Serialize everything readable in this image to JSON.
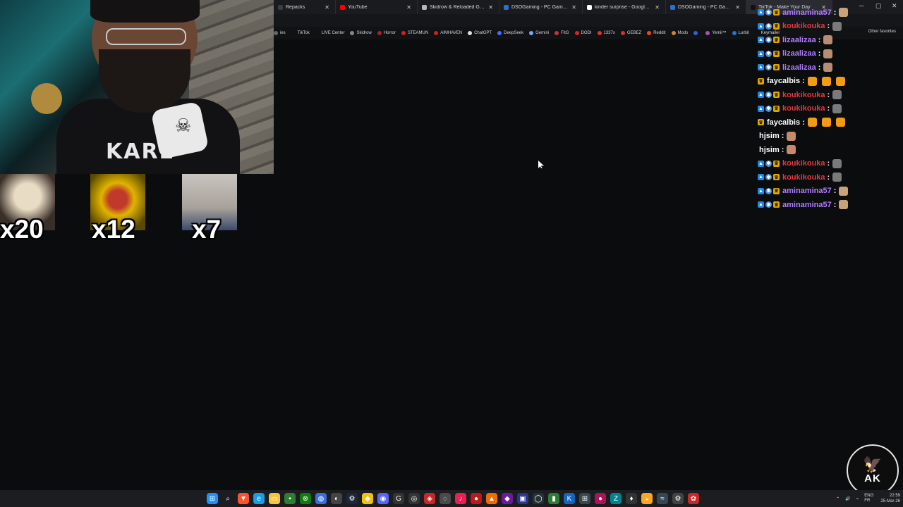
{
  "browser": {
    "tabs": [
      {
        "label": "Repacks",
        "color": "#3b3d42",
        "active": false
      },
      {
        "label": "YouTube",
        "color": "#ff0000",
        "active": false
      },
      {
        "label": "Skidrow & Reloaded Games – D",
        "color": "#b8b8b8",
        "active": false
      },
      {
        "label": "DSOGaming - PC Games News, S",
        "color": "#2a6fd6",
        "active": false
      },
      {
        "label": "kinder surprise - Google Search",
        "color": "#ffffff",
        "active": false
      },
      {
        "label": "DSOGaming - PC Games News, S",
        "color": "#2a6fd6",
        "active": false
      },
      {
        "label": "TikTok - Make Your Day",
        "color": "#111111",
        "active": true
      }
    ],
    "window_controls": [
      "─",
      "▢",
      "✕"
    ],
    "bookmarks": [
      {
        "label": "ies",
        "color": "#666666"
      },
      {
        "label": "TikTok",
        "color": "#111111"
      },
      {
        "label": "LIVE Center",
        "color": "#111111"
      },
      {
        "label": "Skidrow",
        "color": "#888888"
      },
      {
        "label": "Horror",
        "color": "#aa2222"
      },
      {
        "label": "STEAMUN",
        "color": "#cc2222"
      },
      {
        "label": "AIMHAVEN",
        "color": "#cc2222"
      },
      {
        "label": "ChatGPT",
        "color": "#dddddd"
      },
      {
        "label": "DeepSeek",
        "color": "#4d6bfe"
      },
      {
        "label": "Gemini",
        "color": "#7aa7ff"
      },
      {
        "label": "FitG",
        "color": "#cc3333"
      },
      {
        "label": "DODI",
        "color": "#dd2222"
      },
      {
        "label": "1337x",
        "color": "#dd3333"
      },
      {
        "label": "GEBEZ",
        "color": "#cc3333"
      },
      {
        "label": "Reddit",
        "color": "#ff4500"
      },
      {
        "label": "Mods",
        "color": "#d9822b"
      },
      {
        "label": "",
        "color": "#3b5bdb"
      },
      {
        "label": "Yemii™",
        "color": "#9b59b6"
      },
      {
        "label": "Lurbit",
        "color": "#2a6fd6"
      },
      {
        "label": "Keymailer",
        "color": "#111111"
      }
    ],
    "other_favorites": "Other favorites"
  },
  "gifts": [
    {
      "count": "x20",
      "color": "#d8c7a6"
    },
    {
      "count": "x12",
      "color": "#e0b400"
    },
    {
      "count": "x7",
      "color": "#b7b2ad"
    }
  ],
  "chat": [
    {
      "user": "aminamina57",
      "color": "#b07cff",
      "badges": 3,
      "emotes": [
        "#c9a27a"
      ]
    },
    {
      "user": "koukikouka",
      "color": "#e5383b",
      "badges": 3,
      "emotes": [
        "#7a7a7a"
      ]
    },
    {
      "user": "lizaalizaa",
      "color": "#b07cff",
      "badges": 3,
      "emotes": [
        "#b98c74"
      ]
    },
    {
      "user": "lizaalizaa",
      "color": "#b07cff",
      "badges": 3,
      "emotes": [
        "#b98c74"
      ]
    },
    {
      "user": "lizaalizaa",
      "color": "#b07cff",
      "badges": 3,
      "emotes": [
        "#b98c74"
      ]
    },
    {
      "user": "faycalbis",
      "color": "#ffffff",
      "badges": 1,
      "emotes": [
        "#f39c12",
        "#f39c12",
        "#f39c12"
      ]
    },
    {
      "user": "koukikouka",
      "color": "#e5383b",
      "badges": 3,
      "emotes": [
        "#7a7a7a"
      ]
    },
    {
      "user": "koukikouka",
      "color": "#e5383b",
      "badges": 3,
      "emotes": [
        "#7a7a7a"
      ]
    },
    {
      "user": "faycalbis",
      "color": "#ffffff",
      "badges": 1,
      "emotes": [
        "#f39c12",
        "#f39c12",
        "#f39c12"
      ]
    },
    {
      "user": "hjsim",
      "color": "#ffffff",
      "badges": 0,
      "emotes": [
        "#c58a6a"
      ]
    },
    {
      "user": "hjsim",
      "color": "#ffffff",
      "badges": 0,
      "emotes": [
        "#c58a6a"
      ]
    },
    {
      "user": "koukikouka",
      "color": "#e5383b",
      "badges": 3,
      "emotes": [
        "#7a7a7a"
      ]
    },
    {
      "user": "koukikouka",
      "color": "#e5383b",
      "badges": 3,
      "emotes": [
        "#7a7a7a"
      ]
    },
    {
      "user": "aminamina57",
      "color": "#b07cff",
      "badges": 3,
      "emotes": [
        "#c9a27a"
      ]
    },
    {
      "user": "aminamina57",
      "color": "#b07cff",
      "badges": 3,
      "emotes": [
        "#c9a27a"
      ]
    }
  ],
  "chat_separator": ":",
  "webcam": {
    "shirt_text": "KARL"
  },
  "logo": {
    "mark": "AK"
  },
  "taskbar": {
    "icons": [
      {
        "name": "windows-start-icon",
        "color": "#1e90ff",
        "glyph": "⊞"
      },
      {
        "name": "search-icon",
        "color": "transparent",
        "glyph": "⌕"
      },
      {
        "name": "brave-icon",
        "color": "#fb542b",
        "glyph": "▼"
      },
      {
        "name": "edge-icon",
        "color": "#1b9de2",
        "glyph": "e"
      },
      {
        "name": "file-explorer-icon",
        "color": "#f5c542",
        "glyph": "▭"
      },
      {
        "name": "app-green-icon",
        "color": "#2e7d32",
        "glyph": "▪"
      },
      {
        "name": "xbox-icon",
        "color": "#107c10",
        "glyph": "⊗"
      },
      {
        "name": "app-blue-icon",
        "color": "#3a6fd8",
        "glyph": "◍"
      },
      {
        "name": "app-circle-icon",
        "color": "#444444",
        "glyph": "◐"
      },
      {
        "name": "steam-icon",
        "color": "#1b2838",
        "glyph": "⚙"
      },
      {
        "name": "app-yellow-icon",
        "color": "#f4c20d",
        "glyph": "◆"
      },
      {
        "name": "discord-icon",
        "color": "#5865f2",
        "glyph": "◉"
      },
      {
        "name": "google-icon",
        "color": "#333333",
        "glyph": "G"
      },
      {
        "name": "obs-icon",
        "color": "#333333",
        "glyph": "◎"
      },
      {
        "name": "app-red-icon",
        "color": "#c62828",
        "glyph": "◈"
      },
      {
        "name": "app-grey-icon",
        "color": "#4a4a4a",
        "glyph": "◌"
      },
      {
        "name": "tiktok-icon",
        "color": "#ee1d52",
        "glyph": "♪"
      },
      {
        "name": "app-red2-icon",
        "color": "#b71c1c",
        "glyph": "●"
      },
      {
        "name": "app-orange-icon",
        "color": "#ef6c00",
        "glyph": "▲"
      },
      {
        "name": "app-purple-icon",
        "color": "#6a1b9a",
        "glyph": "◆"
      },
      {
        "name": "app-blue2-icon",
        "color": "#283593",
        "glyph": "▣"
      },
      {
        "name": "app-dark-icon",
        "color": "#263238",
        "glyph": "◯"
      },
      {
        "name": "app-bars-icon",
        "color": "#2e7d32",
        "glyph": "▮"
      },
      {
        "name": "app-k-icon",
        "color": "#1565c0",
        "glyph": "K"
      },
      {
        "name": "app-grid-icon",
        "color": "#37474f",
        "glyph": "⊞"
      },
      {
        "name": "app-pink-icon",
        "color": "#ad1457",
        "glyph": "●"
      },
      {
        "name": "app-teal-icon",
        "color": "#00838f",
        "glyph": "Z"
      },
      {
        "name": "app-mic-icon",
        "color": "#333333",
        "glyph": "♦"
      },
      {
        "name": "app-gold-icon",
        "color": "#f9a825",
        "glyph": "◒"
      },
      {
        "name": "app-wave-icon",
        "color": "#37474f",
        "glyph": "≈"
      },
      {
        "name": "settings-icon",
        "color": "#424242",
        "glyph": "⚙"
      },
      {
        "name": "app-flower-icon",
        "color": "#c62828",
        "glyph": "✿"
      }
    ],
    "tray": {
      "lang": "ENG",
      "region": "FR",
      "time": "22:59",
      "date": "25-Mar-26"
    }
  }
}
